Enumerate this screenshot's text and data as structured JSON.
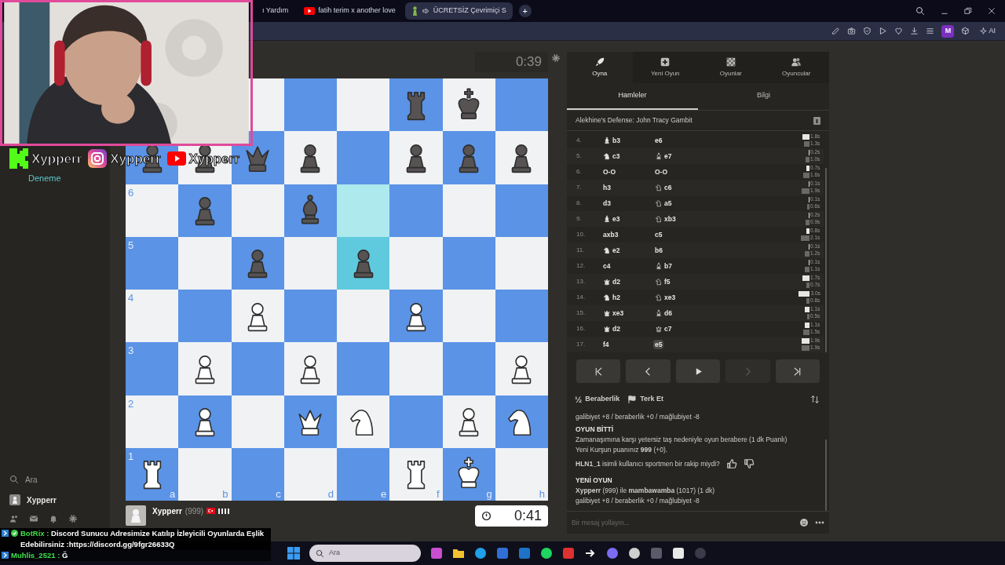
{
  "browser": {
    "tabs": [
      {
        "title": "ı Yardım",
        "kind": "plain",
        "selected": false
      },
      {
        "title": "fatih terim x another love",
        "kind": "video",
        "selected": false
      },
      {
        "title": "ÜCRETSİZ Çevrimiçi S",
        "kind": "chess",
        "audio": true,
        "selected": true
      }
    ],
    "new_tab": "+",
    "profile": "M",
    "ai": "AI"
  },
  "stream_overlay": {
    "handles": [
      {
        "kind": "kick",
        "handle": "Xypperr"
      },
      {
        "kind": "instagram",
        "handle": "Xypperr"
      },
      {
        "kind": "youtube",
        "handle": "Xypperr"
      }
    ],
    "chat": [
      {
        "user": "BotRix :",
        "verified": true,
        "message": "Discord Sunucu Adresimize Katılıp İzleyicili Oyunlarda Eşlik Edebilirsiniz :https://discord.gg/9fgr26633Q"
      },
      {
        "user": "Muhlis_2521 :",
        "verified": false,
        "message": "Ğ"
      }
    ]
  },
  "sidebar": {
    "items": [
      {
        "label": "Deneme"
      }
    ],
    "search": "Ara",
    "user": "Xypperr"
  },
  "board": {
    "top_clock": "0:39",
    "rank_labels": [
      "6",
      "5",
      "4",
      "3",
      "2",
      "1"
    ],
    "file_labels": [
      "a",
      "b",
      "c",
      "d",
      "e",
      "f",
      "g",
      "h"
    ],
    "rows": [
      [
        {},
        {},
        {
          "highlighted": false
        },
        {
          "highlighted": false
        },
        {
          "highlighted": false
        },
        {
          "kind": "rook",
          "color": "#565352",
          "highlighted": false
        },
        {
          "kind": "king",
          "color": "#565352",
          "highlighted": false
        },
        {
          "highlighted": false
        }
      ],
      [
        {
          "kind": "pawn",
          "color": "#565352",
          "highlighted": false
        },
        {
          "kind": "pawn",
          "color": "#565352",
          "highlighted": false
        },
        {
          "kind": "queen",
          "color": "#565352",
          "highlighted": false
        },
        {
          "kind": "pawn",
          "color": "#565352",
          "highlighted": false
        },
        {
          "highlighted": false
        },
        {
          "kind": "pawn",
          "color": "#565352",
          "highlighted": false
        },
        {
          "kind": "pawn",
          "color": "#565352",
          "highlighted": false
        },
        {
          "kind": "pawn",
          "color": "#565352",
          "highlighted": false
        }
      ],
      [
        {
          "highlighted": false
        },
        {
          "kind": "pawn",
          "color": "#565352",
          "highlighted": false
        },
        {
          "highlighted": false
        },
        {
          "kind": "bishop",
          "color": "#565352",
          "highlighted": false
        },
        {
          "highlighted": true
        },
        {
          "highlighted": false
        },
        {
          "highlighted": false
        },
        {
          "highlighted": false
        }
      ],
      [
        {
          "highlighted": false
        },
        {
          "highlighted": false
        },
        {
          "kind": "pawn",
          "color": "#565352",
          "highlighted": false
        },
        {
          "highlighted": false
        },
        {
          "kind": "pawn",
          "color": "#565352",
          "highlighted": true
        },
        {
          "highlighted": false
        },
        {
          "highlighted": false
        },
        {
          "highlighted": false
        }
      ],
      [
        {
          "highlighted": false
        },
        {
          "highlighted": false
        },
        {
          "kind": "pawn",
          "color": "#ffffff",
          "highlighted": false
        },
        {
          "highlighted": false
        },
        {
          "highlighted": false
        },
        {
          "kind": "pawn",
          "color": "#ffffff",
          "highlighted": false
        },
        {
          "highlighted": false
        },
        {
          "highlighted": false
        }
      ],
      [
        {
          "highlighted": false
        },
        {
          "kind": "pawn",
          "color": "#ffffff",
          "highlighted": false
        },
        {
          "highlighted": false
        },
        {
          "kind": "pawn",
          "color": "#ffffff",
          "highlighted": false
        },
        {
          "highlighted": false
        },
        {
          "highlighted": false
        },
        {
          "highlighted": false
        },
        {
          "kind": "pawn",
          "color": "#ffffff",
          "highlighted": false
        }
      ],
      [
        {
          "highlighted": false
        },
        {
          "kind": "pawn",
          "color": "#ffffff",
          "highlighted": false
        },
        {
          "highlighted": false
        },
        {
          "kind": "queen",
          "color": "#ffffff",
          "highlighted": false
        },
        {
          "kind": "knight",
          "color": "#ffffff",
          "highlighted": false
        },
        {
          "highlighted": false
        },
        {
          "kind": "pawn",
          "color": "#ffffff",
          "highlighted": false
        },
        {
          "kind": "knight",
          "color": "#ffffff",
          "highlighted": false
        }
      ],
      [
        {
          "kind": "rook",
          "color": "#ffffff",
          "highlighted": false
        },
        {
          "highlighted": false
        },
        {
          "highlighted": false
        },
        {
          "highlighted": false
        },
        {
          "highlighted": false
        },
        {
          "kind": "rook",
          "color": "#ffffff",
          "highlighted": false
        },
        {
          "kind": "king",
          "color": "#ffffff",
          "highlighted": false
        },
        {
          "highlighted": false
        }
      ]
    ],
    "player": {
      "name": "Xypperr",
      "rating": "(999)",
      "clock": "0:41"
    }
  },
  "panel": {
    "tabs": [
      {
        "label": "Oyna",
        "selected": true
      },
      {
        "label": "Yeni Oyun",
        "selected": false
      },
      {
        "label": "Oyunlar",
        "selected": false
      },
      {
        "label": "Oyuncular",
        "selected": false
      }
    ],
    "subtabs": [
      {
        "label": "Hamleler",
        "selected": true
      },
      {
        "label": "Bilgi",
        "selected": false
      }
    ],
    "opening": "Alekhine's Defense: John Tracy Gambit",
    "moves": [
      {
        "no": "4.",
        "white": {
          "kind": "bishop",
          "san": "b3",
          "selected": false
        },
        "black": {
          "san": "e6",
          "selected": false
        },
        "times": [
          "1.8s",
          "1.3s"
        ]
      },
      {
        "no": "5.",
        "white": {
          "kind": "knight",
          "san": "c3",
          "selected": false
        },
        "black": {
          "kind": "bishop",
          "san": "e7",
          "selected": false
        },
        "times": [
          "0.2s",
          "1.0s"
        ]
      },
      {
        "no": "6.",
        "white": {
          "san": "O-O",
          "selected": false
        },
        "black": {
          "san": "O-O",
          "selected": false
        },
        "times": [
          "0.7s",
          "1.6s"
        ]
      },
      {
        "no": "7.",
        "white": {
          "san": "h3",
          "selected": false
        },
        "black": {
          "kind": "knight",
          "san": "c6",
          "selected": false
        },
        "times": [
          "0.1s",
          "1.9s"
        ]
      },
      {
        "no": "8.",
        "white": {
          "san": "d3",
          "selected": false
        },
        "black": {
          "kind": "knight",
          "san": "a5",
          "selected": false
        },
        "times": [
          "0.1s",
          "0.6s"
        ]
      },
      {
        "no": "9.",
        "white": {
          "kind": "bishop",
          "san": "e3",
          "selected": false
        },
        "black": {
          "kind": "knight",
          "san": "xb3",
          "selected": false
        },
        "times": [
          "0.2s",
          "0.9s"
        ]
      },
      {
        "no": "10.",
        "white": {
          "san": "axb3",
          "selected": false
        },
        "black": {
          "san": "c5",
          "selected": false
        },
        "times": [
          "0.8s",
          "2.1s"
        ]
      },
      {
        "no": "11.",
        "white": {
          "kind": "knight",
          "san": "e2",
          "selected": false
        },
        "black": {
          "san": "b6",
          "selected": false
        },
        "times": [
          "0.1s",
          "1.2s"
        ]
      },
      {
        "no": "12.",
        "white": {
          "san": "c4",
          "selected": false
        },
        "black": {
          "kind": "bishop",
          "san": "b7",
          "selected": false
        },
        "times": [
          "0.1s",
          "1.1s"
        ]
      },
      {
        "no": "13.",
        "white": {
          "kind": "queen",
          "san": "d2",
          "selected": false
        },
        "black": {
          "kind": "knight",
          "san": "f5",
          "selected": false
        },
        "times": [
          "1.7s",
          "0.7s"
        ]
      },
      {
        "no": "14.",
        "white": {
          "kind": "knight",
          "san": "h2",
          "selected": false
        },
        "black": {
          "kind": "knight",
          "san": "xe3",
          "selected": false
        },
        "times": [
          "3.0s",
          "0.8s"
        ]
      },
      {
        "no": "15.",
        "white": {
          "kind": "queen",
          "san": "xe3",
          "selected": false
        },
        "black": {
          "kind": "bishop",
          "san": "d6",
          "selected": false
        },
        "times": [
          "1.1s",
          "0.5s"
        ]
      },
      {
        "no": "16.",
        "white": {
          "kind": "queen",
          "san": "d2",
          "selected": false
        },
        "black": {
          "kind": "queen",
          "san": "c7",
          "selected": false
        },
        "times": [
          "1.1s",
          "1.5s"
        ]
      },
      {
        "no": "17.",
        "white": {
          "san": "f4",
          "selected": false
        },
        "black": {
          "san": "e5",
          "selected": true
        },
        "times": [
          "1.9s",
          "1.9s"
        ]
      }
    ],
    "nav": [
      {
        "kind": "first",
        "disabled": false
      },
      {
        "kind": "prev",
        "disabled": false
      },
      {
        "kind": "play",
        "disabled": false
      },
      {
        "kind": "next",
        "disabled": true
      },
      {
        "kind": "last",
        "disabled": false
      }
    ],
    "actions": [
      {
        "kind": "draw",
        "icon": "½",
        "label": "Beraberlik"
      },
      {
        "kind": "resign",
        "label": "Terk Et"
      }
    ],
    "chat": [
      {
        "kind": "text",
        "text": "galibiyet +8 / beraberlik +0 / mağlubiyet -8"
      },
      {
        "kind": "heading",
        "text": "OYUN BİTTİ"
      },
      {
        "kind": "text",
        "text": "Zamanaşımına karşı yetersiz taş nedeniyle oyun berabere (1 dk Puanlı)"
      },
      {
        "kind": "text",
        "text": "Yeni Kurşun puanınız **999** (+0)."
      },
      {
        "kind": "question",
        "text": "**HLN1_1** isimli kullanıcı sportmen bir rakip miydi?"
      },
      {
        "kind": "heading",
        "text": "YENİ OYUN"
      },
      {
        "kind": "text",
        "text": "**Xypperr** (999) ile **mambawamba** (1017) (1 dk)"
      },
      {
        "kind": "text",
        "text": "galibiyet +8 / beraberlik +0 / mağlubiyet -8"
      }
    ],
    "chat_placeholder": "Bir mesaj yollayın..."
  },
  "taskbar": {
    "search": "Ara"
  }
}
